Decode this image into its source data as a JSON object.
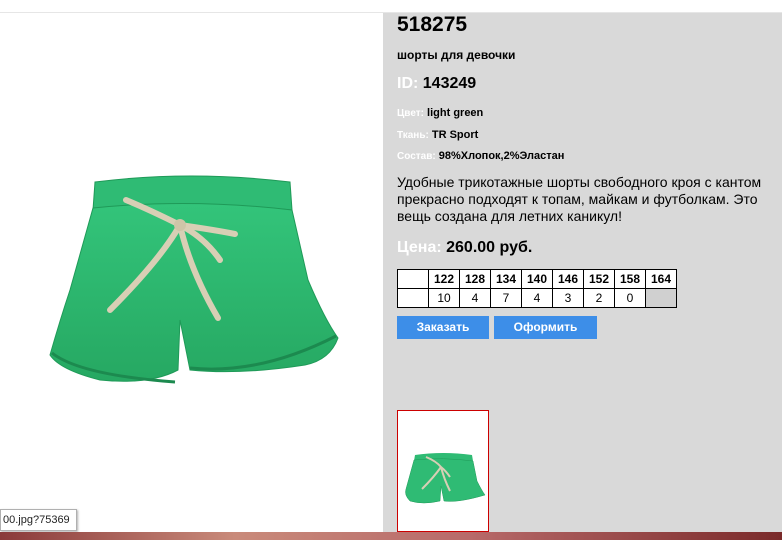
{
  "product": {
    "code": "518275",
    "subtitle": "шорты для девочки",
    "id_label": "ID:",
    "id_value": "143249",
    "attributes": [
      {
        "label": "Цвет:",
        "value": "light green"
      },
      {
        "label": "Ткань:",
        "value": "TR Sport"
      },
      {
        "label": "Состав:",
        "value": "98%Хлопок,2%Эластан"
      }
    ],
    "description": "Удобные трикотажные шорты свободного кроя с кантом прекрасно подходят к топам, майкам и футболкам. Это вещь создана для летних каникул!",
    "price_label": "Цена:",
    "price_value": "260.00 руб."
  },
  "sizes": {
    "headers": [
      "",
      "122",
      "128",
      "134",
      "140",
      "146",
      "152",
      "158",
      "164"
    ],
    "quantities": [
      "",
      "10",
      "4",
      "7",
      "4",
      "3",
      "2",
      "0",
      ""
    ]
  },
  "buttons": {
    "order": "Заказать",
    "checkout": "Оформить"
  },
  "status_tooltip": "00.jpg?75369",
  "colors": {
    "panel_bg": "#d9d9d9",
    "button_bg": "#3d8ee8",
    "shorts_green": "#2fbf72",
    "thumb_border": "#cc0000"
  }
}
